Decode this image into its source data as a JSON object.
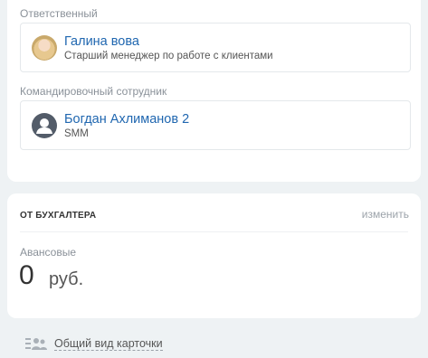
{
  "responsible": {
    "label": "Ответственный",
    "name": "Галина вова",
    "role": "Старший менеджер по работе с клиентами",
    "avatar_icon": "user-photo-icon"
  },
  "business_trip": {
    "label": "Командировочный сотрудник",
    "name": "Богдан Ахлиманов 2",
    "role": "SMM",
    "avatar_icon": "user-default-icon"
  },
  "accountant": {
    "title": "ОТ БУХГАЛТЕРА",
    "edit_label": "изменить",
    "advance_label": "Авансовые",
    "amount": "0",
    "currency": "руб."
  },
  "footer": {
    "link_label": "Общий вид карточки",
    "icon": "users-list-icon"
  },
  "colors": {
    "link": "#2067b0",
    "background": "#eef2f4",
    "avatar_default": "#535c69"
  }
}
